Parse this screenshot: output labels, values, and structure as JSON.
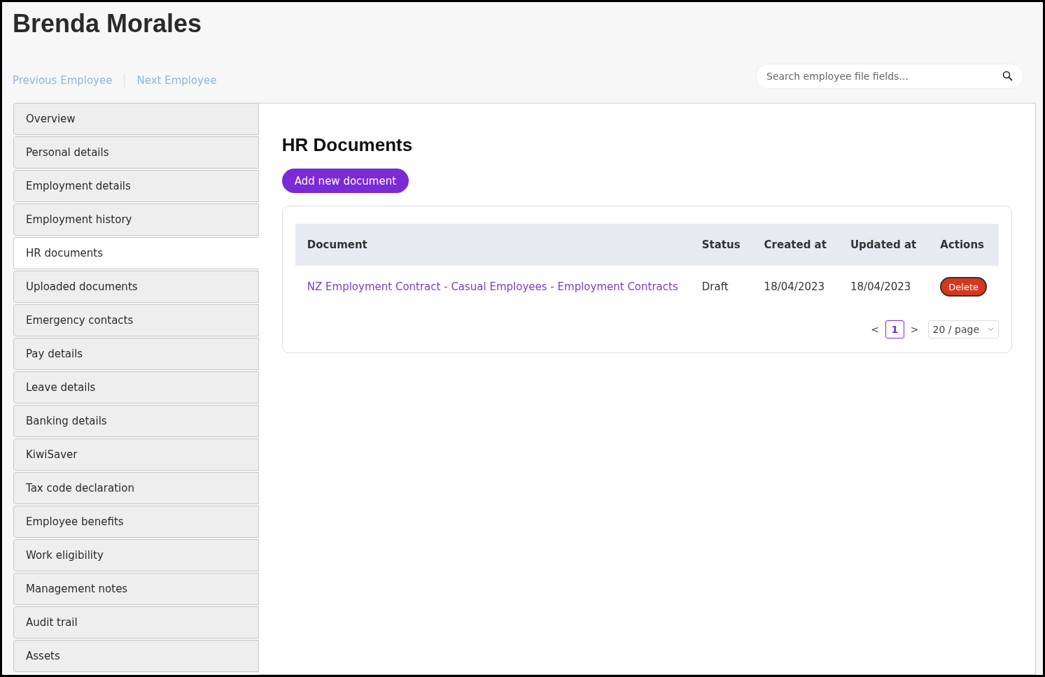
{
  "header": {
    "title": "Brenda Morales",
    "nav_links": [
      "Previous Employee",
      "Next Employee"
    ],
    "search": {
      "placeholder": "Search employee file fields..."
    }
  },
  "sidebar": {
    "items": [
      {
        "label": "Overview",
        "selected": false
      },
      {
        "label": "Personal details",
        "selected": false
      },
      {
        "label": "Employment details",
        "selected": false
      },
      {
        "label": "Employment history",
        "selected": false
      },
      {
        "label": "HR documents",
        "selected": true
      },
      {
        "label": "Uploaded documents",
        "selected": false
      },
      {
        "label": "Emergency contacts",
        "selected": false
      },
      {
        "label": "Pay details",
        "selected": false
      },
      {
        "label": "Leave details",
        "selected": false
      },
      {
        "label": "Banking details",
        "selected": false
      },
      {
        "label": "KiwiSaver",
        "selected": false
      },
      {
        "label": "Tax code declaration",
        "selected": false
      },
      {
        "label": "Employee benefits",
        "selected": false
      },
      {
        "label": "Work eligibility",
        "selected": false
      },
      {
        "label": "Management notes",
        "selected": false
      },
      {
        "label": "Audit trail",
        "selected": false
      },
      {
        "label": "Assets",
        "selected": false
      }
    ]
  },
  "main": {
    "title": "HR Documents",
    "add_button": "Add new document",
    "table": {
      "columns": [
        "Document",
        "Status",
        "Created at",
        "Updated at",
        "Actions"
      ],
      "rows": [
        {
          "document": "NZ Employment Contract - Casual Employees - Employment Contracts",
          "status": "Draft",
          "created_at": "18/04/2023",
          "updated_at": "18/04/2023",
          "action": "Delete"
        }
      ]
    },
    "pagination": {
      "prev": "<",
      "pages": [
        {
          "label": "1",
          "selected": true
        }
      ],
      "next": ">",
      "page_size": "20 / page"
    }
  }
}
